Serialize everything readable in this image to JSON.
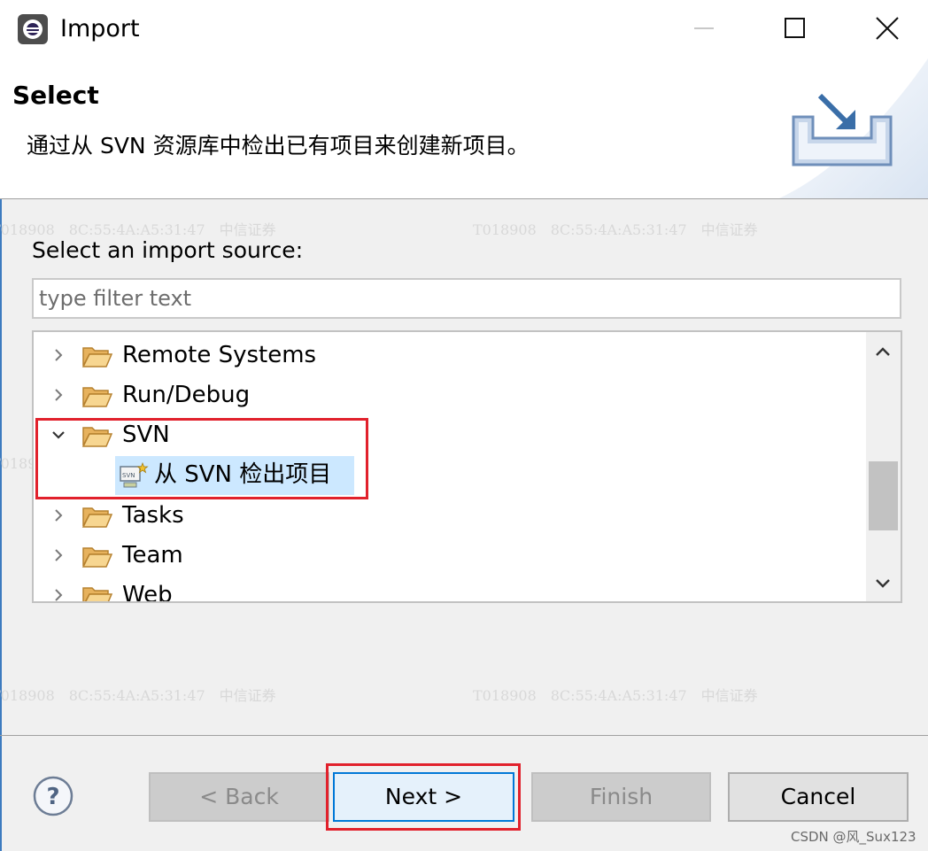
{
  "window": {
    "title": "Import",
    "icons": {
      "app": "eclipse-app-icon",
      "minimize": "minimize-icon",
      "maximize": "maximize-icon",
      "close": "close-icon"
    }
  },
  "header": {
    "title": "Select",
    "description": "通过从 SVN 资源库中检出已有项目来创建新项目。",
    "art_icon": "import-wizard-icon"
  },
  "watermark": {
    "text": "T018908　8C:55:4A:A5:31:47　中信证券"
  },
  "source": {
    "label": "Select an import source:",
    "filter_placeholder": "type filter text",
    "filter_value": ""
  },
  "tree": {
    "items": [
      {
        "label": "Remote Systems",
        "expanded": false,
        "icon": "folder-icon"
      },
      {
        "label": "Run/Debug",
        "expanded": false,
        "icon": "folder-icon"
      },
      {
        "label": "SVN",
        "expanded": true,
        "icon": "folder-open-icon"
      },
      {
        "label": "从 SVN 检出项目",
        "selected": true,
        "icon": "svn-checkout-icon"
      },
      {
        "label": "Tasks",
        "expanded": false,
        "icon": "folder-icon"
      },
      {
        "label": "Team",
        "expanded": false,
        "icon": "folder-icon"
      },
      {
        "label": "Web",
        "expanded": false,
        "icon": "folder-icon"
      }
    ]
  },
  "buttons": {
    "back": "< Back",
    "next": "Next >",
    "finish": "Finish",
    "cancel": "Cancel"
  },
  "footer": {
    "help_icon": "help-icon",
    "credit": "CSDN @风_Sux123"
  },
  "colors": {
    "highlight": "#e1212c",
    "selection": "#cce8ff",
    "default_button_border": "#0078d7"
  }
}
